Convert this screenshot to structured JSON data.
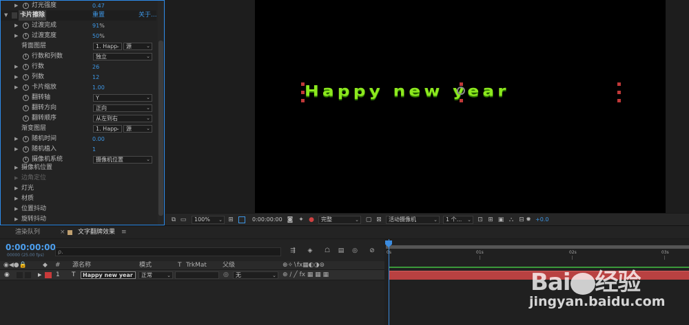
{
  "effect_controls": {
    "top_row": {
      "name": "灯光强度",
      "value": "0.47"
    },
    "effect": {
      "name": "卡片擦除",
      "reset": "重置",
      "about": "关于..."
    },
    "props": [
      {
        "name": "过渡完成",
        "value": "91",
        "unit": "%"
      },
      {
        "name": "过渡宽度",
        "value": "50",
        "unit": "%"
      },
      {
        "name": "背面图层",
        "dd1": "1. Happ",
        "dd2": "源"
      },
      {
        "name": "行数和列数",
        "dd1": "独立"
      },
      {
        "name": "行数",
        "value": "26"
      },
      {
        "name": "列数",
        "value": "12"
      },
      {
        "name": "卡片缩放",
        "value": "1.00"
      },
      {
        "name": "翻转轴",
        "dd1": "Y"
      },
      {
        "name": "翻转方向",
        "dd1": "正向"
      },
      {
        "name": "翻转顺序",
        "dd1": "从左到右"
      },
      {
        "name": "渐变图层",
        "dd1": "1. Happ",
        "dd2": "源"
      },
      {
        "name": "随机时间",
        "value": "0.00"
      },
      {
        "name": "随机植入",
        "value": "1"
      },
      {
        "name": "摄像机系统",
        "dd1": "摄像机位置"
      }
    ],
    "groups": [
      "摄像机位置",
      "边角定位",
      "灯光",
      "材质",
      "位置抖动",
      "旋转抖动"
    ]
  },
  "viewer": {
    "text": "Happy new year",
    "toolbar": {
      "zoom": "100%",
      "timecode": "0:00:00:00",
      "resolution": "完整",
      "camera": "活动摄像机",
      "views": "1 个...",
      "exposure": "+0.0"
    }
  },
  "timeline": {
    "tabs": [
      "渲染队列",
      "文字翻牌效果"
    ],
    "timecode": "0:00:00:00",
    "fps": "00000 (25.00 fps)",
    "search_placeholder": "ρ.",
    "headers": {
      "num": "#",
      "source": "源名称",
      "mode": "模式",
      "t": "T",
      "trkmat": "TrkMat",
      "parent": "父级"
    },
    "layer": {
      "num": "1",
      "type": "T",
      "name": "Happy new year",
      "mode": "正常",
      "parent": "无"
    },
    "ticks": [
      "0s",
      "01s",
      "02s",
      "03s"
    ]
  },
  "watermark": {
    "logo": "Bai",
    "logo_cn": "经验",
    "url": "jingyan.baidu.com"
  },
  "colors": {
    "accent": "#3d97e6",
    "text_green": "#8ce81e",
    "layer_bar": "#b94141"
  }
}
